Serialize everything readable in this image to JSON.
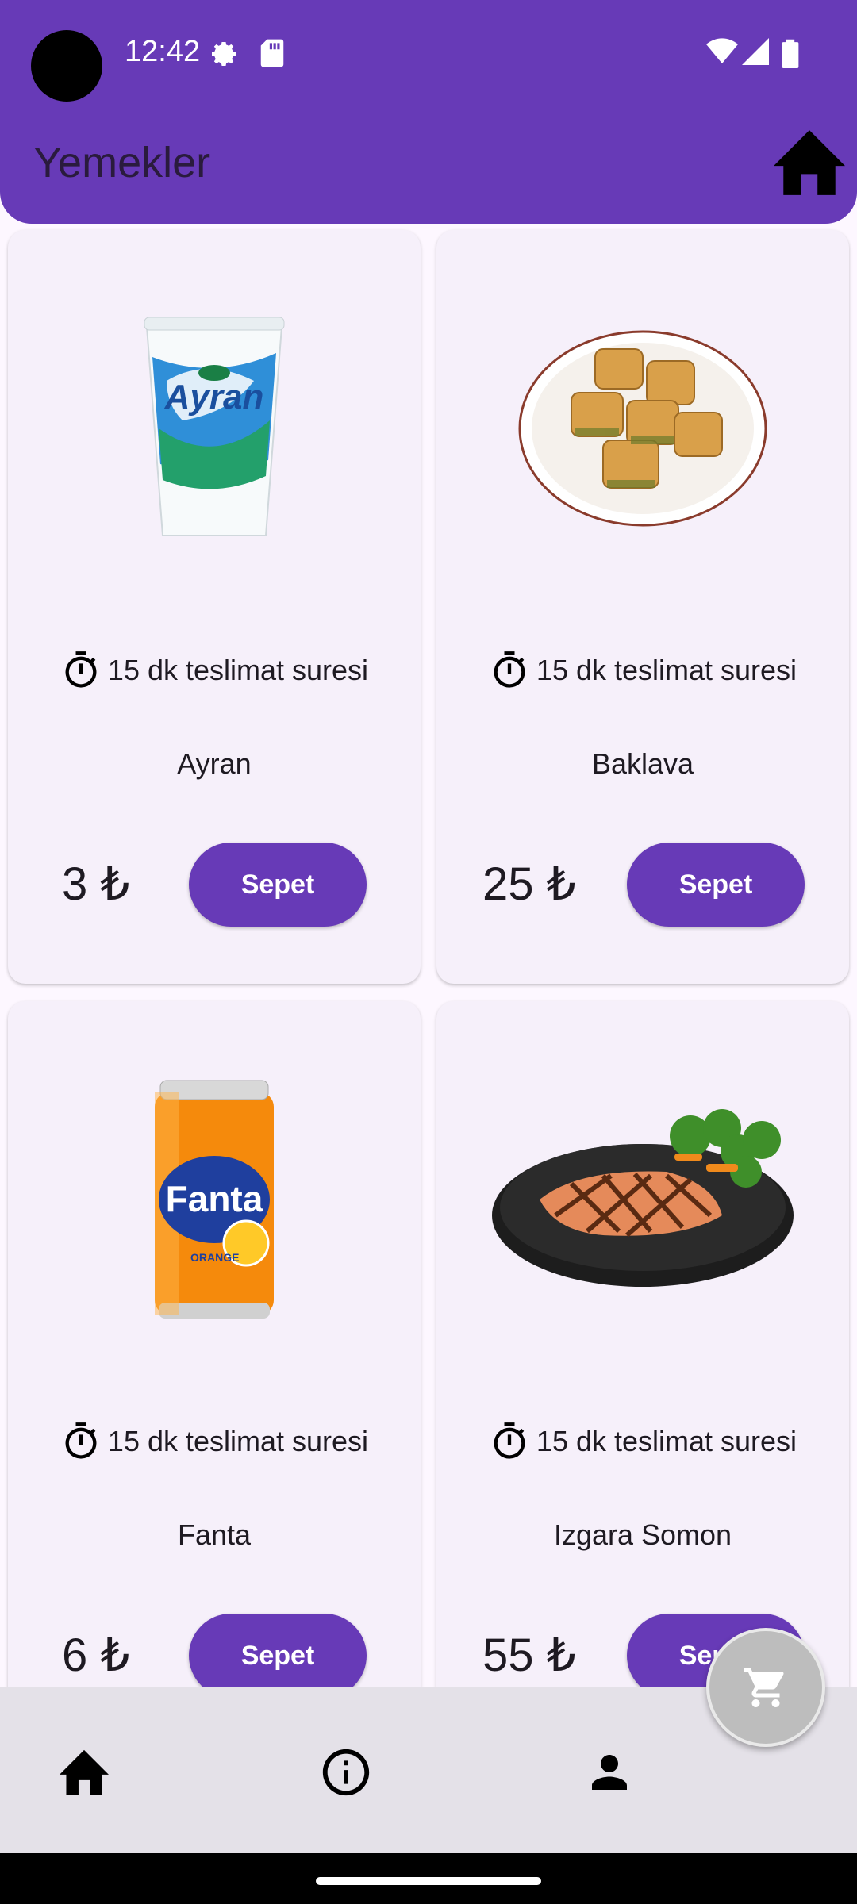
{
  "status_bar": {
    "time": "12:42"
  },
  "header": {
    "title": "Yemekler"
  },
  "products": [
    {
      "name": "Ayran",
      "price": "3 ₺",
      "delivery": "15 dk teslimat suresi",
      "button": "Sepet",
      "image": "ayran-cup"
    },
    {
      "name": "Baklava",
      "price": "25 ₺",
      "delivery": "15 dk teslimat suresi",
      "button": "Sepet",
      "image": "baklava-plate"
    },
    {
      "name": "Fanta",
      "price": "6 ₺",
      "delivery": "15 dk teslimat suresi",
      "button": "Sepet",
      "image": "fanta-can"
    },
    {
      "name": "Izgara Somon",
      "price": "55 ₺",
      "delivery": "15 dk teslimat suresi",
      "button": "Sepet",
      "image": "grilled-salmon"
    }
  ],
  "bottom_nav": {
    "items": [
      "home-icon",
      "info-icon",
      "person-icon"
    ]
  },
  "fab": {
    "icon": "cart-icon"
  },
  "colors": {
    "primary": "#673ab7",
    "card": "#f6f0fa",
    "nav": "#e4e1e8",
    "fab": "#bdbdbd"
  }
}
